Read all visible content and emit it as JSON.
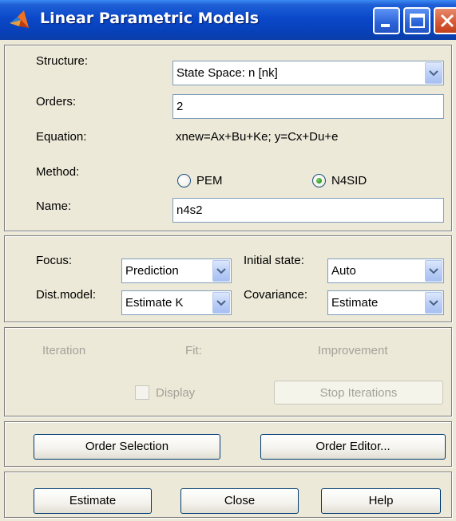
{
  "window": {
    "title": "Linear Parametric Models",
    "title_icon": "matlab-logo-icon",
    "controls": [
      "minimize-icon",
      "maximize-icon",
      "close-icon"
    ]
  },
  "structure_panel": {
    "structure_label": "Structure:",
    "structure_value": "State Space: n [nk]",
    "orders_label": "Orders:",
    "orders_value": "2",
    "equation_label": "Equation:",
    "equation_value": "xnew=Ax+Bu+Ke; y=Cx+Du+e",
    "method_label": "Method:",
    "method_options": [
      {
        "label": "PEM",
        "selected": false
      },
      {
        "label": "N4SID",
        "selected": true
      }
    ],
    "name_label": "Name:",
    "name_value": "n4s2"
  },
  "options_panel": {
    "focus_label": "Focus:",
    "focus_value": "Prediction",
    "initial_state_label": "Initial state:",
    "initial_state_value": "Auto",
    "dist_model_label": "Dist.model:",
    "dist_model_value": "Estimate K",
    "covariance_label": "Covariance:",
    "covariance_value": "Estimate"
  },
  "iteration_panel": {
    "iteration_label": "Iteration",
    "fit_label": "Fit:",
    "improvement_label": "Improvement",
    "display_label": "Display",
    "display_checked": false,
    "stop_button": "Stop Iterations"
  },
  "order_panel": {
    "order_selection_button": "Order Selection",
    "order_editor_button": "Order Editor..."
  },
  "action_panel": {
    "estimate_button": "Estimate",
    "close_button": "Close",
    "help_button": "Help"
  },
  "colors": {
    "titlebar": "#0a48c9",
    "window_bg": "#ece9d8",
    "disabled_text": "#a3a299",
    "radio_selected": "#2c9b1e"
  }
}
